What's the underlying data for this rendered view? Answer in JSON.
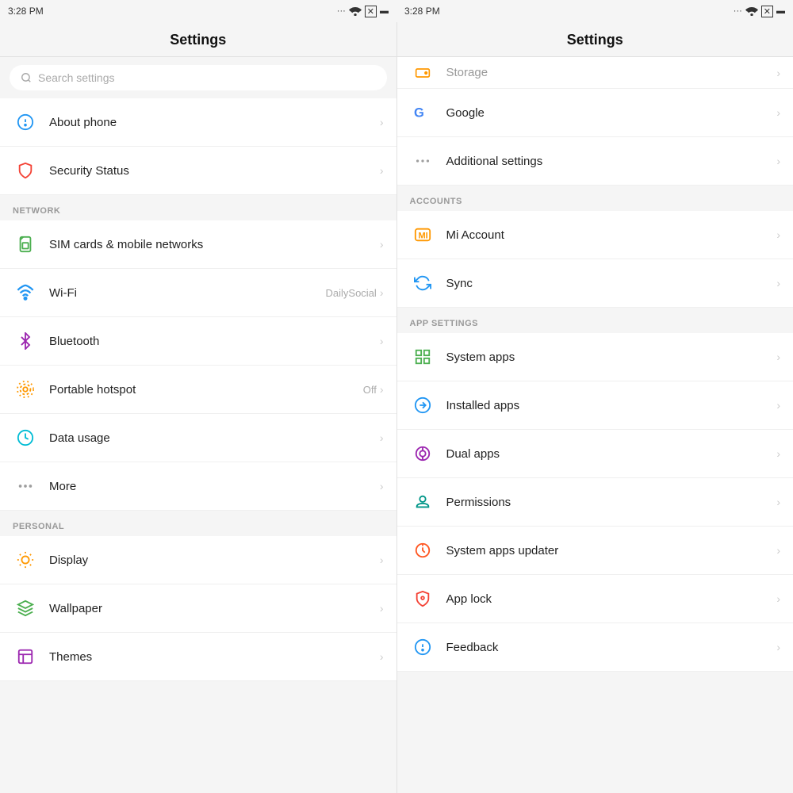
{
  "statusBar": {
    "leftTime": "3:28 PM",
    "rightTime": "3:28 PM"
  },
  "leftPanel": {
    "title": "Settings",
    "search": {
      "placeholder": "Search settings"
    },
    "items": [
      {
        "id": "about-phone",
        "label": "About phone",
        "icon": "info",
        "iconColor": "#2196F3",
        "value": ""
      },
      {
        "id": "security-status",
        "label": "Security Status",
        "icon": "shield",
        "iconColor": "#f44336",
        "value": ""
      }
    ],
    "sections": [
      {
        "label": "NETWORK",
        "items": [
          {
            "id": "sim-cards",
            "label": "SIM cards & mobile networks",
            "icon": "sim",
            "iconColor": "#4CAF50",
            "value": ""
          },
          {
            "id": "wifi",
            "label": "Wi-Fi",
            "icon": "wifi",
            "iconColor": "#2196F3",
            "value": "DailySocial"
          },
          {
            "id": "bluetooth",
            "label": "Bluetooth",
            "icon": "bluetooth",
            "iconColor": "#9C27B0",
            "value": ""
          },
          {
            "id": "hotspot",
            "label": "Portable hotspot",
            "icon": "hotspot",
            "iconColor": "#FF9800",
            "value": "Off"
          },
          {
            "id": "data-usage",
            "label": "Data usage",
            "icon": "data",
            "iconColor": "#00BCD4",
            "value": ""
          },
          {
            "id": "more",
            "label": "More",
            "icon": "dots",
            "iconColor": "#9E9E9E",
            "value": ""
          }
        ]
      },
      {
        "label": "PERSONAL",
        "items": [
          {
            "id": "display",
            "label": "Display",
            "icon": "display",
            "iconColor": "#FF9800",
            "value": ""
          },
          {
            "id": "wallpaper",
            "label": "Wallpaper",
            "icon": "wallpaper",
            "iconColor": "#4CAF50",
            "value": ""
          },
          {
            "id": "themes",
            "label": "Themes",
            "icon": "themes",
            "iconColor": "#9C27B0",
            "value": ""
          }
        ]
      }
    ]
  },
  "rightPanel": {
    "title": "Settings",
    "partialItem": "Storage",
    "items": [
      {
        "id": "google",
        "label": "Google",
        "icon": "google",
        "iconColor": "#4CAF50",
        "value": ""
      },
      {
        "id": "additional-settings",
        "label": "Additional settings",
        "icon": "dots3",
        "iconColor": "#9E9E9E",
        "value": ""
      }
    ],
    "sections": [
      {
        "label": "ACCOUNTS",
        "items": [
          {
            "id": "mi-account",
            "label": "Mi Account",
            "icon": "mi",
            "iconColor": "#FF9800",
            "value": ""
          },
          {
            "id": "sync",
            "label": "Sync",
            "icon": "sync",
            "iconColor": "#2196F3",
            "value": ""
          }
        ]
      },
      {
        "label": "APP SETTINGS",
        "items": [
          {
            "id": "system-apps",
            "label": "System apps",
            "icon": "system-apps",
            "iconColor": "#4CAF50",
            "value": ""
          },
          {
            "id": "installed-apps",
            "label": "Installed apps",
            "icon": "installed-apps",
            "iconColor": "#2196F3",
            "value": ""
          },
          {
            "id": "dual-apps",
            "label": "Dual apps",
            "icon": "dual-apps",
            "iconColor": "#9C27B0",
            "value": ""
          },
          {
            "id": "permissions",
            "label": "Permissions",
            "icon": "permissions",
            "iconColor": "#009688",
            "value": ""
          },
          {
            "id": "system-apps-updater",
            "label": "System apps updater",
            "icon": "updater",
            "iconColor": "#FF5722",
            "value": ""
          },
          {
            "id": "app-lock",
            "label": "App lock",
            "icon": "app-lock",
            "iconColor": "#f44336",
            "value": ""
          }
        ]
      },
      {
        "label": "",
        "items": [
          {
            "id": "feedback",
            "label": "Feedback",
            "icon": "feedback",
            "iconColor": "#2196F3",
            "value": ""
          }
        ]
      }
    ]
  }
}
